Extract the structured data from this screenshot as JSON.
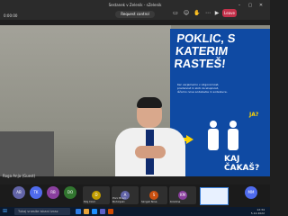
{
  "window": {
    "title": "Sestanek v Zelenik - sZelenik",
    "elapsed": "0:00:00",
    "request_control": "Request control",
    "leave": "Leave"
  },
  "video": {
    "poster_title": "POKLIC, S KATERIM RASTEŠ!",
    "poster_body": "Ker verjamemo v odgovornost, predanost in skrb za skupnost, iščemo nove sodelavke in sodelavce.",
    "poster_ja": "JA?",
    "poster_kaj": "KAJ ČAKAŠ?",
    "caption": "Roga Anja (Guest)"
  },
  "participants": [
    {
      "initials": "AB",
      "color": "#6264a7"
    },
    {
      "initials": "TK",
      "color": "#4f6bed"
    },
    {
      "initials": "RB",
      "color": "#8a3f9e"
    },
    {
      "initials": "DO",
      "color": "#31752f"
    },
    {
      "initials": "",
      "color": "#444"
    },
    {
      "initials": "",
      "color": "#444"
    },
    {
      "initials": "",
      "color": "#444"
    },
    {
      "initials": "MM",
      "color": "#4f6bed"
    }
  ],
  "tiles": [
    {
      "name": "Moj Dom",
      "initial": "D",
      "color": "#c19c00"
    },
    {
      "name": "Poni Brezi - Bohinjski",
      "initial": "A",
      "color": "#6264a7"
    },
    {
      "name": "Skrgat Nina",
      "initial": "S",
      "color": "#ca5010"
    },
    {
      "name": "Kristina",
      "initial": "KM",
      "color": "#8a3f9e"
    }
  ],
  "taskbar": {
    "search_placeholder": "Tukaj vnesite iskani izraz",
    "time": "12:34",
    "date": "5.12.2022"
  }
}
